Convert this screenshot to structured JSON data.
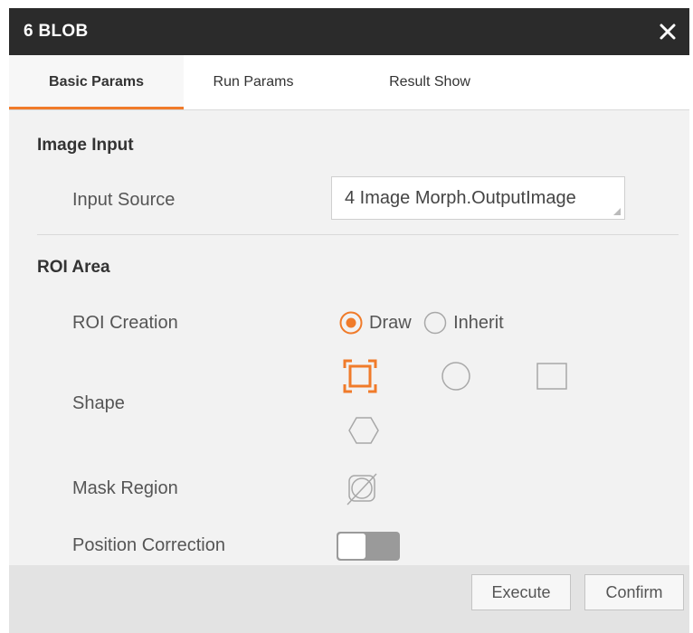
{
  "window": {
    "title": "6 BLOB"
  },
  "tabs": [
    {
      "label": "Basic Params",
      "active": true
    },
    {
      "label": "Run Params",
      "active": false
    },
    {
      "label": "Result Show",
      "active": false
    }
  ],
  "image_input": {
    "section_title": "Image Input",
    "input_source_label": "Input Source",
    "input_source_value": "4 Image Morph.OutputImage"
  },
  "roi_area": {
    "section_title": "ROI Area",
    "roi_creation_label": "ROI Creation",
    "roi_options": [
      {
        "label": "Draw",
        "selected": true
      },
      {
        "label": "Inherit",
        "selected": false
      }
    ],
    "shape_label": "Shape",
    "shapes": [
      "rectangle-select-icon",
      "circle-icon",
      "rectangle-icon",
      "hexagon-icon"
    ],
    "selected_shape": "rectangle-select-icon",
    "mask_region_label": "Mask Region",
    "position_correction_label": "Position Correction",
    "position_correction_enabled": false
  },
  "footer": {
    "execute_label": "Execute",
    "confirm_label": "Confirm"
  },
  "colors": {
    "accent": "#f07b2a",
    "titlebar": "#2b2b2b",
    "panel": "#f2f2f2"
  }
}
